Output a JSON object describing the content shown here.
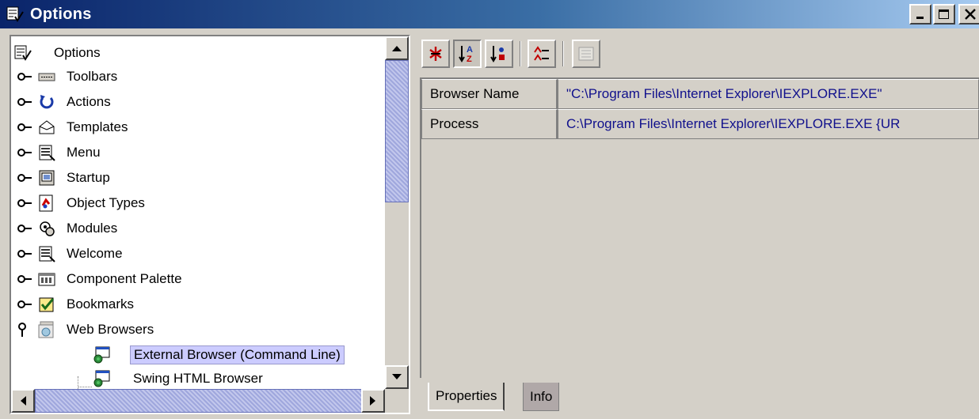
{
  "window": {
    "title": "Options",
    "controls": {
      "minimize": "_",
      "maximize": "□",
      "close": "✕"
    }
  },
  "tree": {
    "root": {
      "label": "Options",
      "icon": "options-icon"
    },
    "items": [
      {
        "label": "Toolbars",
        "icon": "toolbar-icon"
      },
      {
        "label": "Actions",
        "icon": "refresh-icon"
      },
      {
        "label": "Templates",
        "icon": "templates-icon"
      },
      {
        "label": "Menu",
        "icon": "menu-icon"
      },
      {
        "label": "Startup",
        "icon": "startup-icon"
      },
      {
        "label": "Object Types",
        "icon": "object-types-icon"
      },
      {
        "label": "Modules",
        "icon": "modules-icon"
      },
      {
        "label": "Welcome",
        "icon": "welcome-icon"
      },
      {
        "label": "Component Palette",
        "icon": "palette-icon"
      },
      {
        "label": "Bookmarks",
        "icon": "bookmarks-icon"
      },
      {
        "label": "Web Browsers",
        "icon": "web-browsers-icon",
        "expanded": true
      }
    ],
    "children": [
      {
        "label": "External Browser (Command Line)",
        "icon": "browser-icon",
        "selected": true
      },
      {
        "label": "Swing HTML Browser",
        "icon": "browser-icon"
      }
    ]
  },
  "toolbar": {
    "buttons": [
      {
        "name": "unsorted",
        "icon": "unsorted-icon"
      },
      {
        "name": "sort-by-name",
        "icon": "sort-az-icon",
        "pressed": true
      },
      {
        "name": "sort-by-type",
        "icon": "sort-type-icon"
      },
      {
        "name": "show-editable",
        "icon": "editable-icon"
      },
      {
        "name": "customize",
        "icon": "customize-icon",
        "disabled": true
      }
    ]
  },
  "properties": [
    {
      "name": "Browser Name",
      "value": "\"C:\\Program Files\\Internet Explorer\\IEXPLORE.EXE\""
    },
    {
      "name": "Process",
      "value": "C:\\Program Files\\Internet Explorer\\IEXPLORE.EXE  {UR"
    }
  ],
  "tabs": [
    {
      "label": "Properties",
      "active": true
    },
    {
      "label": "Info",
      "active": false
    }
  ],
  "colors": {
    "title_start": "#0a246a",
    "title_end": "#a6caf0",
    "value_text": "#10108c",
    "selection": "#ccccff",
    "scroll_thumb": "#aab0e0"
  }
}
